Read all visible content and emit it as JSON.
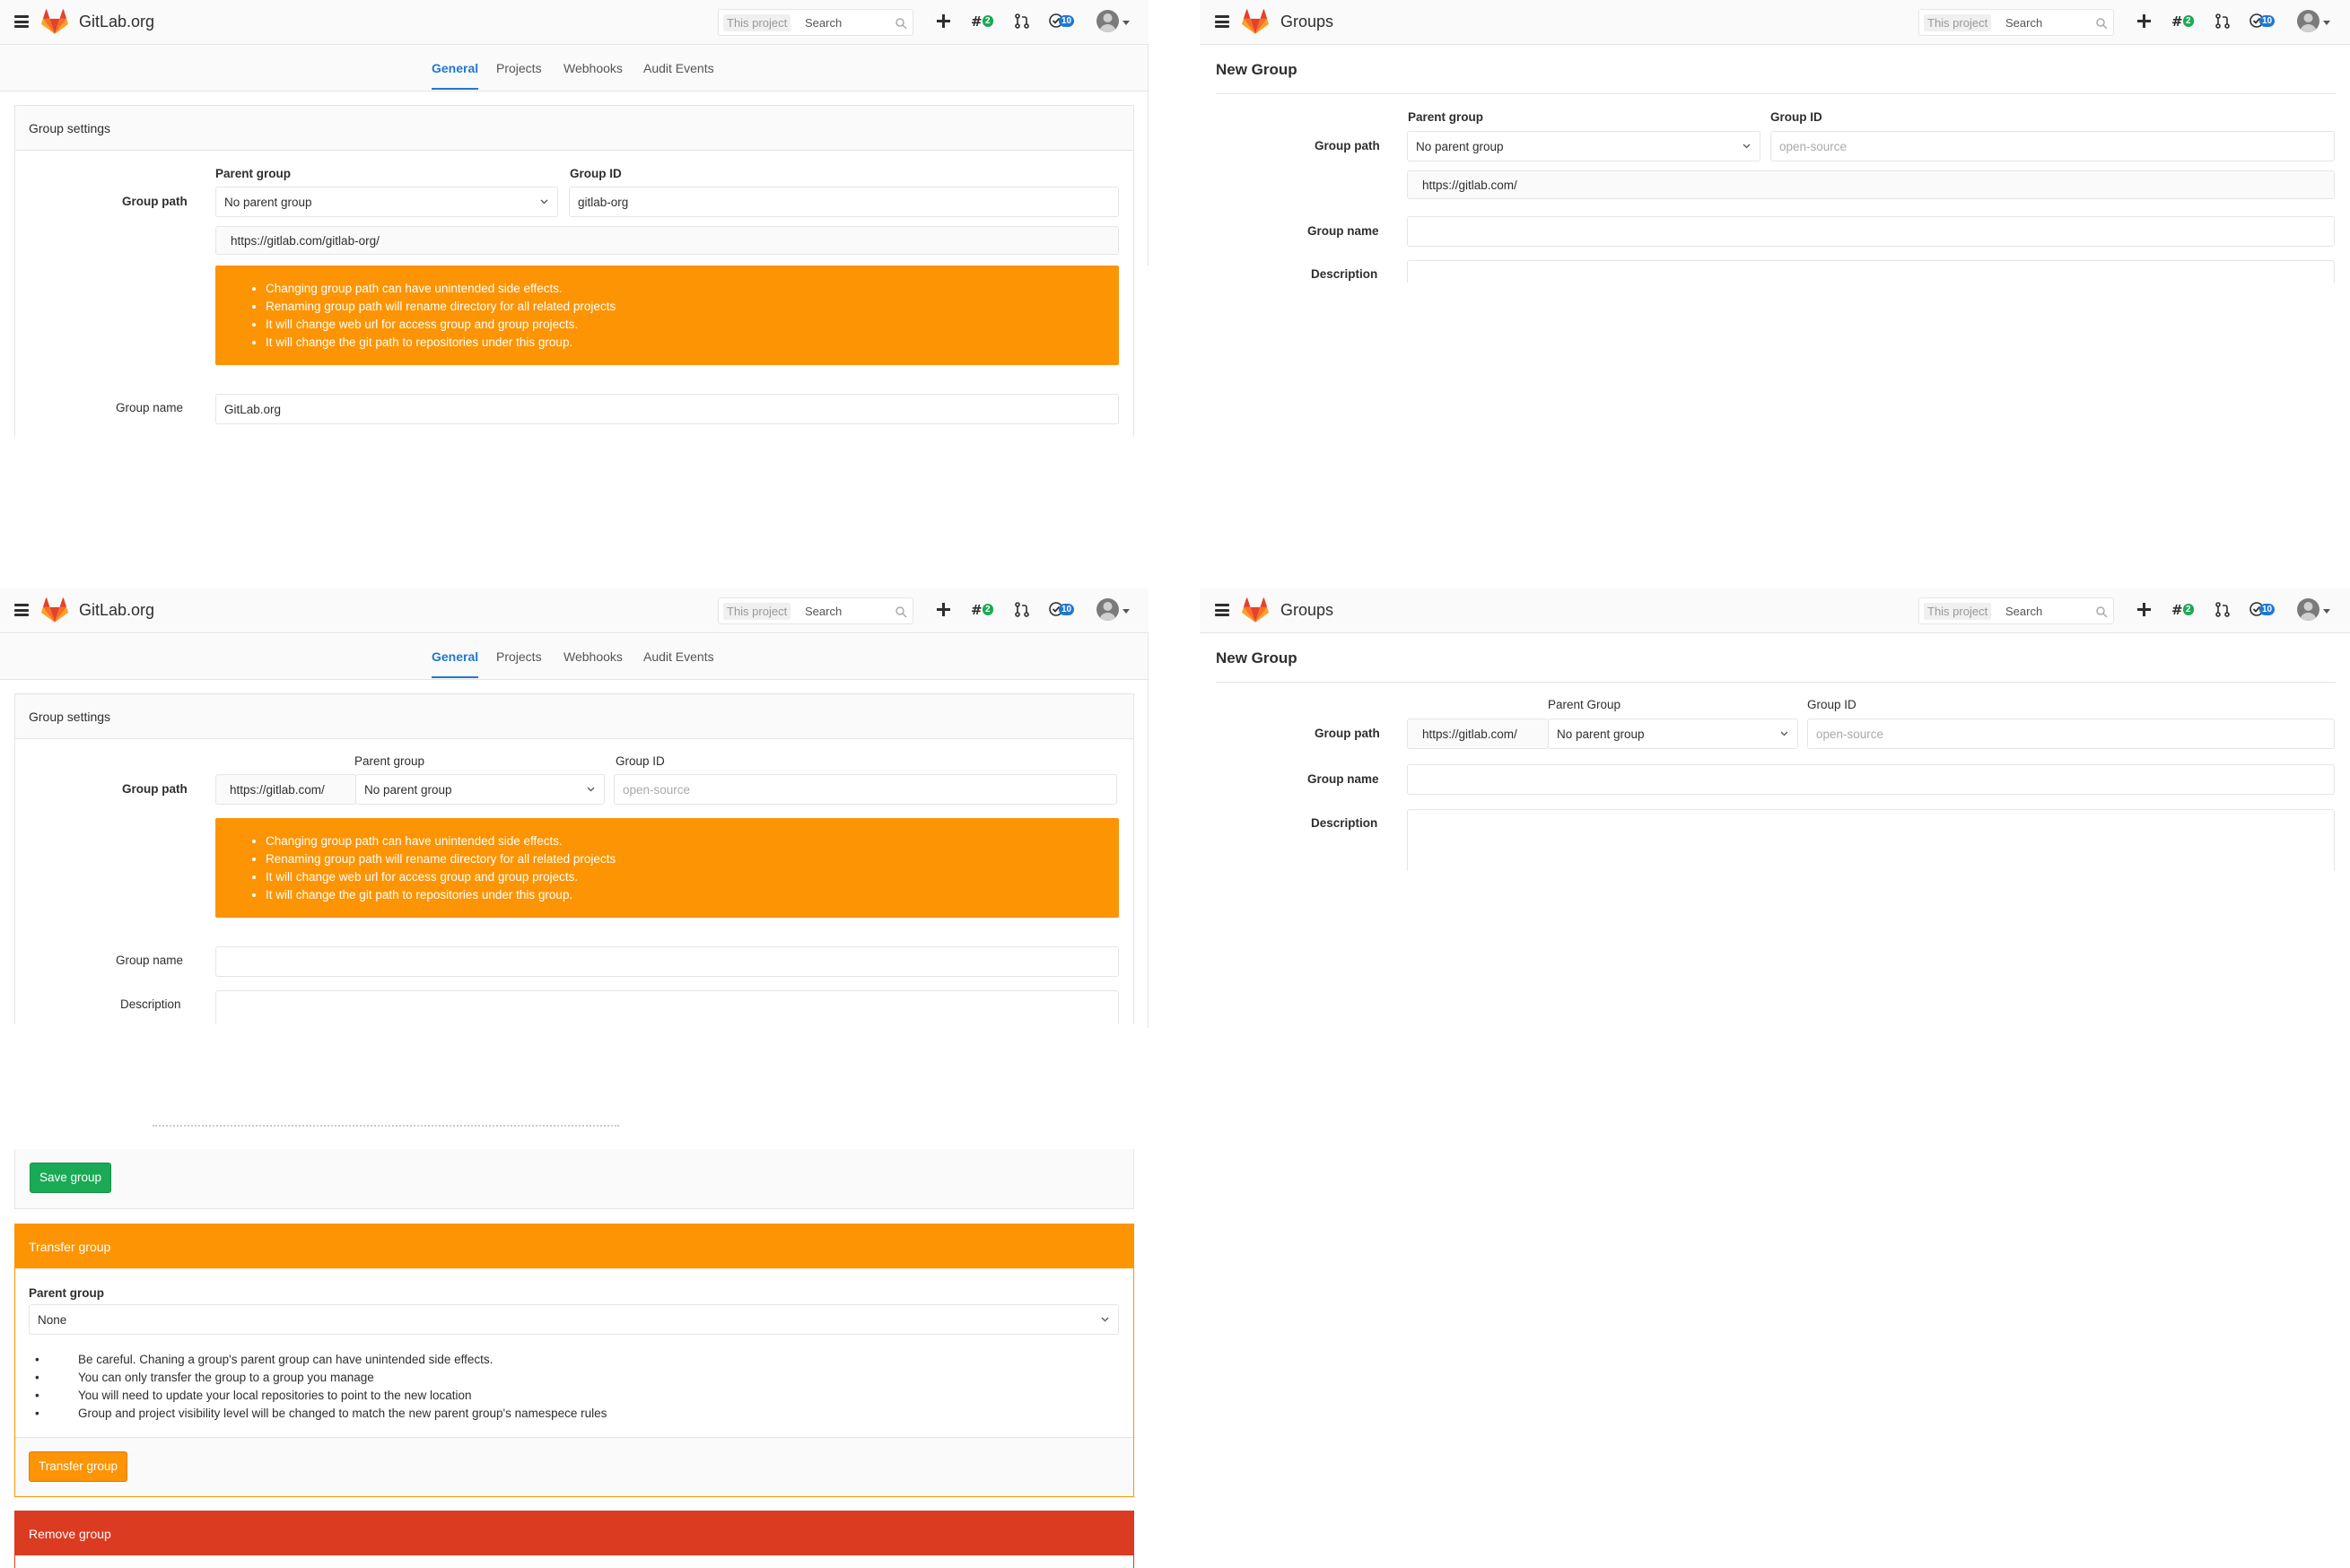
{
  "colors": {
    "accent": "#1f78d1",
    "warning": "#fc9403",
    "danger": "#db3b21",
    "success": "#1aaa55",
    "brand": "#e24329"
  },
  "icons": {
    "menu": "hamburger-icon",
    "logo": "gitlab-tanuki-icon",
    "search": "search-icon",
    "new": "plus-icon",
    "issues": "issues-icon",
    "merge_requests": "merge-request-icon",
    "todos": "todo-icon",
    "user": "avatar"
  },
  "nav": {
    "search_scope": "This project",
    "search_placeholder": "Search",
    "issues_count": "2",
    "todos_count": "10"
  },
  "panel1": {
    "app_title": "GitLab.org",
    "tabs": [
      {
        "label": "General",
        "active": true
      },
      {
        "label": "Projects"
      },
      {
        "label": "Webhooks"
      },
      {
        "label": "Audit Events"
      }
    ],
    "card_title": "Group settings",
    "group_path_label": "Group path",
    "parent_group_label": "Parent group",
    "parent_group_value": "No parent group",
    "group_id_label": "Group ID",
    "group_id_value": "gitlab-org",
    "url_value": "https://gitlab.com/gitlab-org/",
    "warnings": [
      "Changing group path can have unintended side effects.",
      "Renaming group path will rename directory for all related projects",
      "It will change web url for access group and group projects.",
      "It will change the git path to repositories under this group."
    ],
    "group_name_label": "Group name",
    "group_name_value": "GitLab.org"
  },
  "panel2": {
    "app_title": "Groups",
    "page_title": "New Group",
    "parent_group_label": "Parent group",
    "group_id_label": "Group ID",
    "group_path_label": "Group path",
    "parent_group_value": "No parent group",
    "group_id_placeholder": "open-source",
    "url_value": "https://gitlab.com/",
    "group_name_label": "Group name",
    "description_label": "Description"
  },
  "panel3": {
    "app_title": "GitLab.org",
    "tabs": [
      {
        "label": "General",
        "active": true
      },
      {
        "label": "Projects"
      },
      {
        "label": "Webhooks"
      },
      {
        "label": "Audit Events"
      }
    ],
    "card_title": "Group settings",
    "parent_group_label": "Parent group",
    "group_id_label": "Group ID",
    "group_path_label": "Group path",
    "url_prefix": "https://gitlab.com/",
    "parent_group_value": "No parent group",
    "group_id_placeholder": "open-source",
    "warnings": [
      "Changing group path can have unintended side effects.",
      "Renaming group path will rename directory for all related projects",
      "It will change web url for access group and group projects.",
      "It will change the git path to repositories under this group."
    ],
    "group_name_label": "Group name",
    "description_label": "Description"
  },
  "panel4": {
    "app_title": "Groups",
    "page_title": "New Group",
    "parent_group_label": "Parent Group",
    "group_id_label": "Group ID",
    "group_path_label": "Group path",
    "url_prefix": "https://gitlab.com/",
    "parent_group_value": "No parent group",
    "group_id_placeholder": "open-source",
    "group_name_label": "Group name",
    "description_label": "Description"
  },
  "panel5": {
    "save_label": "Save group",
    "transfer_title": "Transfer group",
    "parent_group_label": "Parent group",
    "parent_group_value": "None",
    "notes": [
      "Be careful. Chaning a group's parent group can have unintended side effects.",
      "You can only transfer the group to a group you manage",
      "You will need to update your local repositories to point to the new location",
      "Group and project visibility level will be changed to match the new parent group's namespece rules"
    ],
    "transfer_button": "Transfer group",
    "remove_title": "Remove group"
  }
}
